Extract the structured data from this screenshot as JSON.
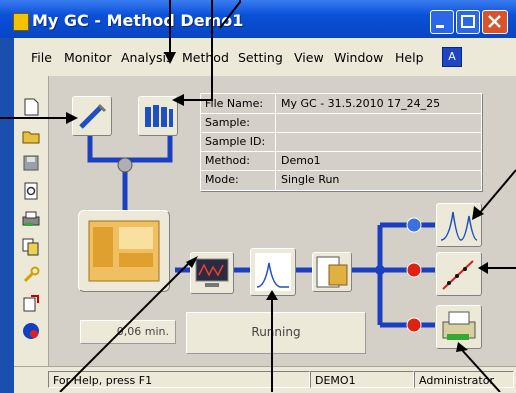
{
  "window": {
    "title": "My GC - Method Demo1"
  },
  "menu": {
    "items": [
      "File",
      "Monitor",
      "Analysis",
      "Method",
      "Setting",
      "View",
      "Window",
      "Help"
    ]
  },
  "info": {
    "rows": [
      {
        "label": "File Name:",
        "value": "My GC - 31.5.2010 17_24_25"
      },
      {
        "label": "Sample:",
        "value": ""
      },
      {
        "label": "Sample ID:",
        "value": ""
      },
      {
        "label": "Method:",
        "value": "Demo1"
      },
      {
        "label": "Mode:",
        "value": "Single Run"
      }
    ]
  },
  "run": {
    "time": "0,06 min.",
    "status": "Running"
  },
  "statusbar": {
    "hint": "For Help, press F1",
    "method": "DEMO1",
    "user": "Administrator"
  },
  "icons": {
    "toolbar": [
      "new-icon",
      "open-icon",
      "save-icon",
      "print-preview-icon",
      "print-icon",
      "copy-icon",
      "wrench-icon",
      "export-icon",
      "help-icon"
    ],
    "devices": [
      "autosampler-icon",
      "vials-icon",
      "gc-oven-icon",
      "detector-signal-icon",
      "chromatogram-icon",
      "calculator-report-icon",
      "overlay-chromatogram-icon",
      "calibration-icon",
      "printer-icon"
    ]
  },
  "colors": {
    "xp_blue": "#0a50d8",
    "pipe_blue": "#1a3fc0",
    "window_bg": "#ece9d8",
    "close_red": "#d8542c"
  }
}
